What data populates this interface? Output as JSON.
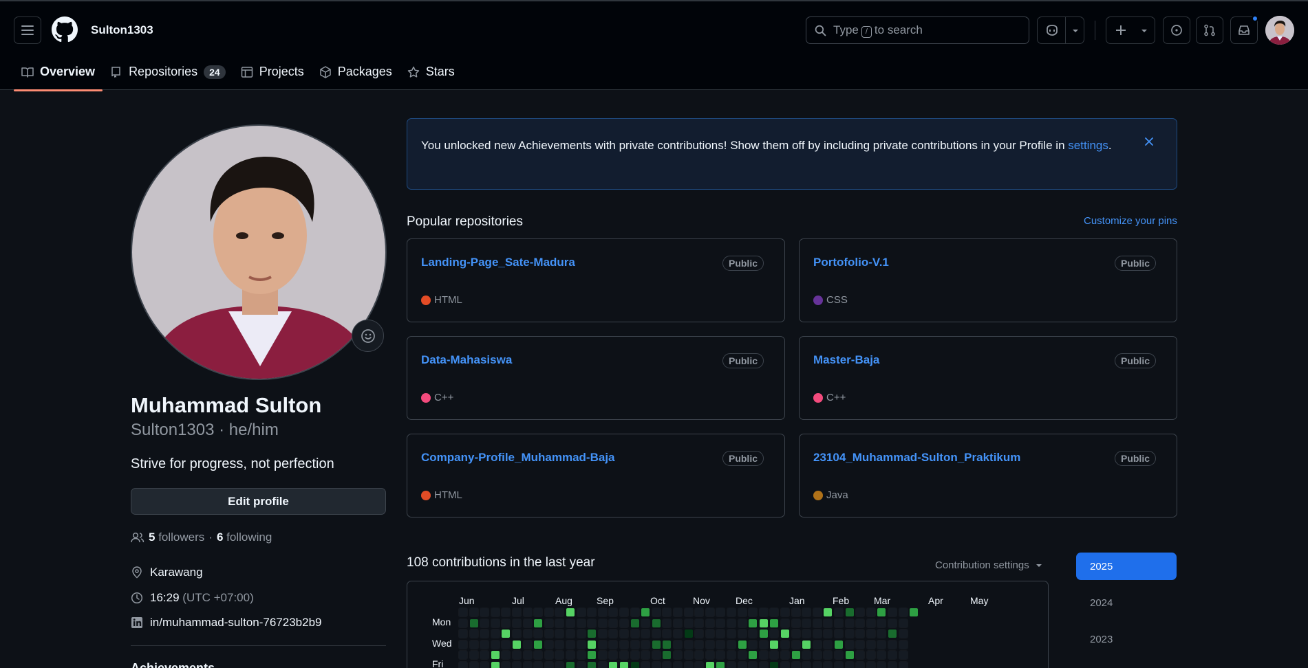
{
  "header": {
    "username": "Sulton1303",
    "search_before": "Type",
    "search_key": "/",
    "search_after": "to search"
  },
  "tabs": [
    {
      "label": "Overview",
      "icon": "book-icon",
      "active": true
    },
    {
      "label": "Repositories",
      "icon": "repo-icon",
      "count": "24"
    },
    {
      "label": "Projects",
      "icon": "table-icon"
    },
    {
      "label": "Packages",
      "icon": "package-icon"
    },
    {
      "label": "Stars",
      "icon": "star-icon"
    }
  ],
  "profile": {
    "name": "Muhammad Sulton",
    "login_line": "Sulton1303 · he/him",
    "bio": "Strive for progress, not perfection",
    "edit_label": "Edit profile",
    "followers_count": "5",
    "followers_label": "followers",
    "separator": "·",
    "following_count": "6",
    "following_label": "following",
    "location": "Karawang",
    "time": "16:29",
    "timezone": "(UTC +07:00)",
    "linkedin": "in/muhammad-sulton-76723b2b9",
    "achievements_heading": "Achievements"
  },
  "flash": {
    "message": "You unlocked new Achievements with private contributions! Show them off by including private contributions in your Profile in",
    "link": "settings",
    "end": "."
  },
  "popular": {
    "title": "Popular repositories",
    "customize": "Customize your pins",
    "repos": [
      {
        "name": "Landing-Page_Sate-Madura",
        "visibility": "Public",
        "language": "HTML",
        "color": "#e34c26"
      },
      {
        "name": "Portofolio-V.1",
        "visibility": "Public",
        "language": "CSS",
        "color": "#663399"
      },
      {
        "name": "Data-Mahasiswa",
        "visibility": "Public",
        "language": "C++",
        "color": "#f34b7d"
      },
      {
        "name": "Master-Baja",
        "visibility": "Public",
        "language": "C++",
        "color": "#f34b7d"
      },
      {
        "name": "Company-Profile_Muhammad-Baja",
        "visibility": "Public",
        "language": "HTML",
        "color": "#e34c26"
      },
      {
        "name": "23104_Muhammad-Sulton_Praktikum",
        "visibility": "Public",
        "language": "Java",
        "color": "#b07219"
      }
    ]
  },
  "contributions": {
    "title": "108 contributions in the last year",
    "settings_label": "Contribution settings",
    "months": [
      "Jun",
      "Jul",
      "Aug",
      "Sep",
      "Oct",
      "Nov",
      "Dec",
      "Jan",
      "Feb",
      "Mar",
      "Apr",
      "May"
    ],
    "days": [
      "Mon",
      "Wed",
      "Fri"
    ],
    "years": [
      "2025",
      "2024",
      "2023"
    ],
    "active_year": "2025",
    "colors": {
      "empty": "#151b23",
      "l1": "#033a16",
      "l2": "#196c2e",
      "l3": "#2ea043",
      "l4": "#56d364"
    }
  }
}
